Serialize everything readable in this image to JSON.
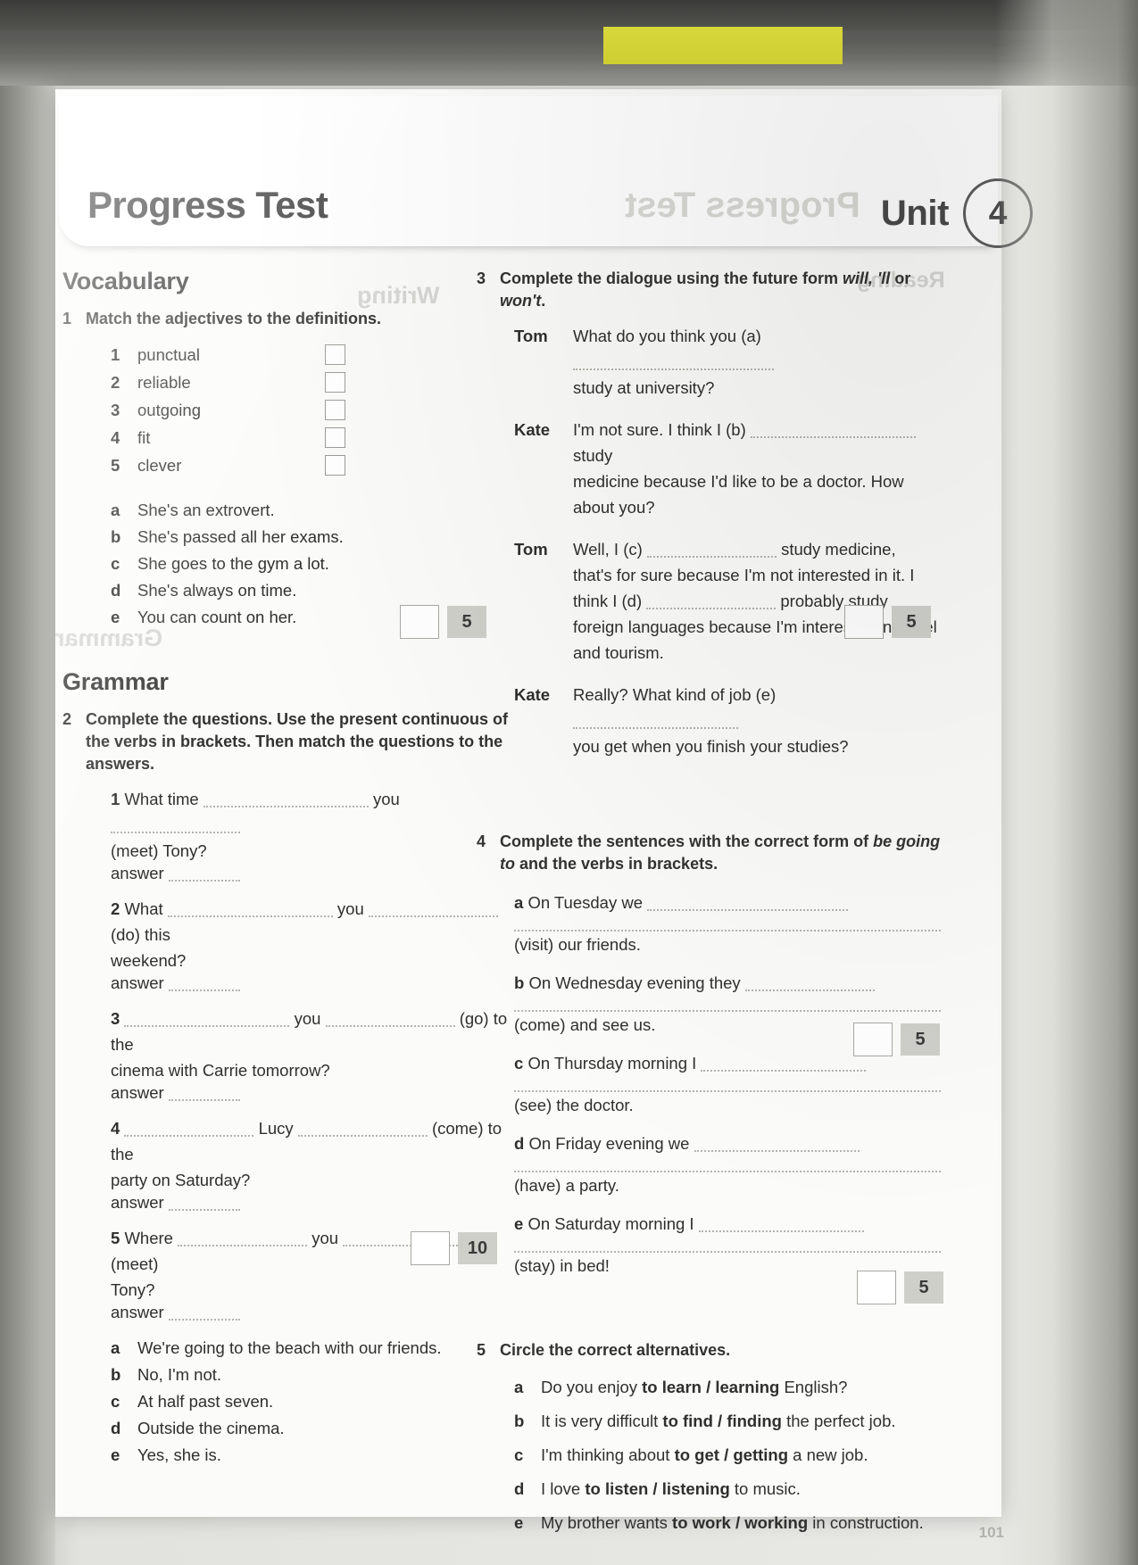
{
  "header": {
    "title": "Progress Test",
    "unit_word": "Unit",
    "unit_number": "4",
    "page_number": "101"
  },
  "sections": {
    "vocabulary": "Vocabulary",
    "grammar": "Grammar"
  },
  "exercise1": {
    "number": "1",
    "instruction": "Match the adjectives to the definitions.",
    "adjectives": [
      {
        "num": "1",
        "word": "punctual"
      },
      {
        "num": "2",
        "word": "reliable"
      },
      {
        "num": "3",
        "word": "outgoing"
      },
      {
        "num": "4",
        "word": "fit"
      },
      {
        "num": "5",
        "word": "clever"
      }
    ],
    "definitions": [
      {
        "lbl": "a",
        "text": "She's an extrovert."
      },
      {
        "lbl": "b",
        "text": "She's passed all her exams."
      },
      {
        "lbl": "c",
        "text": "She goes to the gym a lot."
      },
      {
        "lbl": "d",
        "text": "She's always on time."
      },
      {
        "lbl": "e",
        "text": "You can count on her."
      }
    ],
    "score": "5"
  },
  "exercise2": {
    "number": "2",
    "instruction": "Complete the questions. Use the present continuous of the verbs in brackets. Then match the questions to the answers.",
    "answer_label": "answer",
    "questions": [
      {
        "num": "1",
        "pre": "What time",
        "mid": "you",
        "post": "",
        "tail": "(meet) Tony?"
      },
      {
        "num": "2",
        "pre": "What",
        "mid": "you",
        "post": "(do) this",
        "tail": "weekend?"
      },
      {
        "num": "3",
        "pre": "",
        "mid": "you",
        "post": "(go) to the",
        "tail": "cinema with Carrie tomorrow?"
      },
      {
        "num": "4",
        "pre": "",
        "mid": "Lucy",
        "post": "(come) to the",
        "tail": "party on Saturday?"
      },
      {
        "num": "5",
        "pre": "Where",
        "mid": "you",
        "post": "(meet)",
        "tail": "Tony?"
      }
    ],
    "answers": [
      {
        "lbl": "a",
        "text": "We're going to the beach with our friends."
      },
      {
        "lbl": "b",
        "text": "No, I'm not."
      },
      {
        "lbl": "c",
        "text": "At half past seven."
      },
      {
        "lbl": "d",
        "text": "Outside the cinema."
      },
      {
        "lbl": "e",
        "text": "Yes, she is."
      }
    ],
    "score": "10"
  },
  "exercise3": {
    "number": "3",
    "instruction_part1": "Complete the dialogue using the future form ",
    "instruction_italic": "will, 'll",
    "instruction_mid": " or ",
    "instruction_italic2": "won't",
    "instruction_end": ".",
    "lines": [
      {
        "speaker": "Tom",
        "before": "What do you think you (a)",
        "after": "",
        "rest": "study at university?"
      },
      {
        "speaker": "Kate",
        "before": "I'm not sure. I think I (b)",
        "after": "study",
        "rest": "medicine because I'd like to be a doctor. How about you?"
      },
      {
        "speaker": "Tom",
        "before": "Well, I (c)",
        "after": "study medicine,",
        "rest": "that's for sure because I'm not interested in it. I think I (d)",
        "after2": "probably study",
        "rest2": "foreign languages because I'm interested in travel and tourism."
      },
      {
        "speaker": "Kate",
        "before": "Really? What kind of job (e)",
        "after": "",
        "rest": "you get when you finish your studies?"
      }
    ],
    "score": "5"
  },
  "exercise4": {
    "number": "4",
    "instruction_part1": "Complete the sentences with the correct form of ",
    "instruction_italic": "be going to",
    "instruction_end": " and the verbs in brackets.",
    "items": [
      {
        "lbl": "a",
        "text": "On Tuesday we",
        "verb": "(visit) our friends."
      },
      {
        "lbl": "b",
        "text": "On Wednesday evening they",
        "verb": "(come) and see us."
      },
      {
        "lbl": "c",
        "text": "On Thursday morning I",
        "verb": "(see) the doctor."
      },
      {
        "lbl": "d",
        "text": "On Friday evening we",
        "verb": "(have) a party."
      },
      {
        "lbl": "e",
        "text": "On Saturday morning I",
        "verb": "(stay) in bed!"
      }
    ],
    "score": "5"
  },
  "exercise5": {
    "number": "5",
    "instruction": "Circle the correct alternatives.",
    "items": [
      {
        "lbl": "a",
        "pre": "Do you enjoy ",
        "choice": "to learn / learning",
        "post": " English?"
      },
      {
        "lbl": "b",
        "pre": "It is very difficult ",
        "choice": "to find / finding",
        "post": " the perfect job."
      },
      {
        "lbl": "c",
        "pre": "I'm thinking about ",
        "choice": "to get / getting",
        "post": " a new job."
      },
      {
        "lbl": "d",
        "pre": "I love ",
        "choice": "to listen / listening",
        "post": " to music."
      },
      {
        "lbl": "e",
        "pre": "My brother wants ",
        "choice": "to work / working",
        "post": " in construction."
      }
    ],
    "score": "5"
  },
  "ghost_text": {
    "title_mirror": "Progress Test",
    "writing": "Writing",
    "grammar": "Grammar",
    "reading": "Reading"
  }
}
